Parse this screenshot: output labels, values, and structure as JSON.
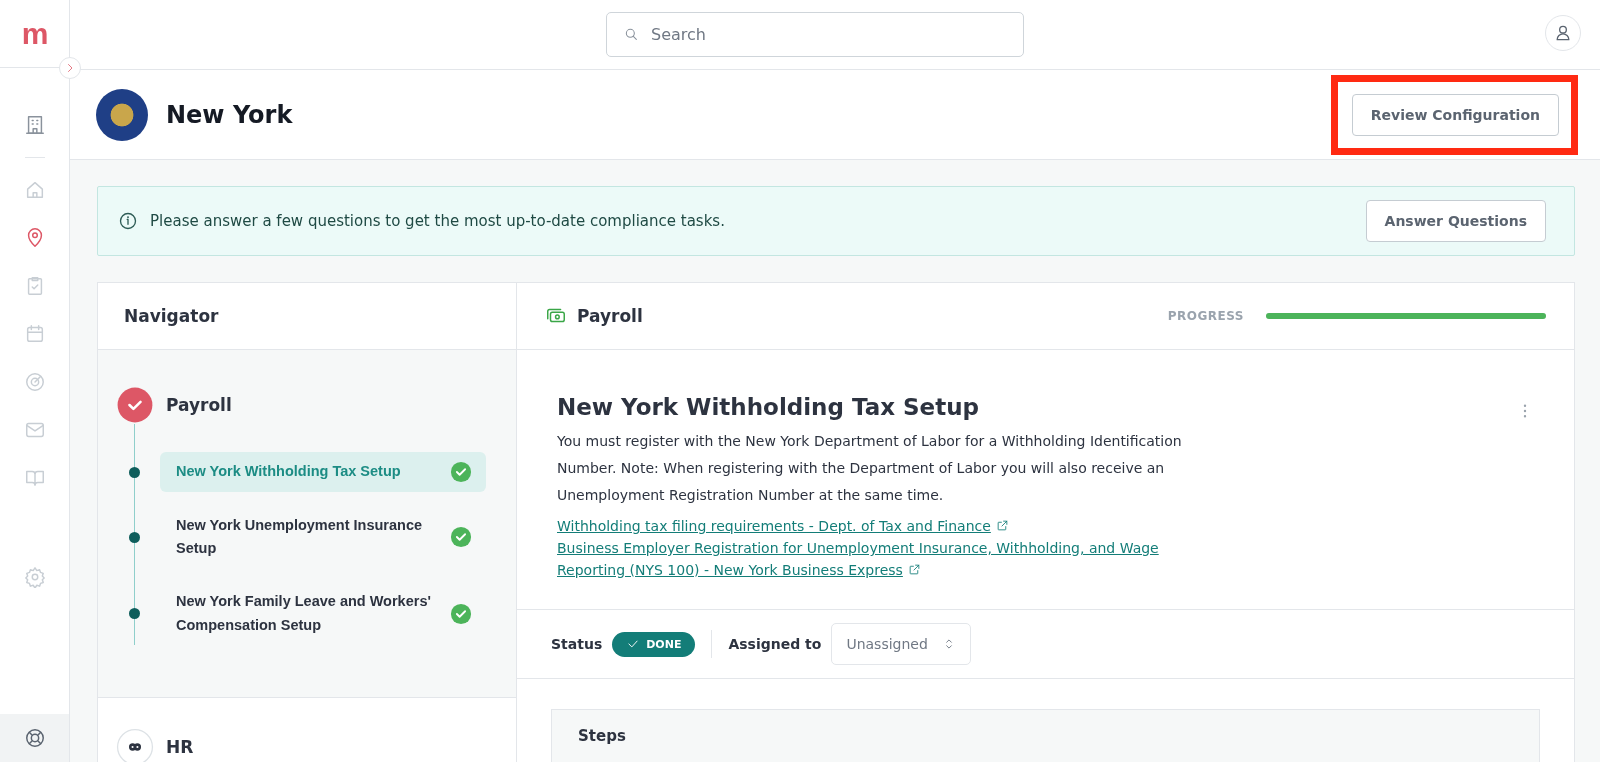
{
  "app": {
    "logo": "m"
  },
  "sidebar": {
    "items": [
      {
        "kind": "building",
        "selected": false
      },
      {
        "kind": "home",
        "selected": false
      },
      {
        "kind": "pin",
        "selected": true
      },
      {
        "kind": "clipboard",
        "selected": false
      },
      {
        "kind": "calendar",
        "selected": false
      },
      {
        "kind": "target",
        "selected": false
      },
      {
        "kind": "mail",
        "selected": false
      },
      {
        "kind": "book",
        "selected": false
      },
      {
        "kind": "gear",
        "selected": false
      }
    ]
  },
  "search": {
    "placeholder": "Search"
  },
  "header": {
    "title": "New York",
    "button": {
      "label": "Review Configuration",
      "highlighted": true
    }
  },
  "banner": {
    "text": "Please answer a few questions to get the most up-to-date compliance tasks.",
    "button": "Answer Questions"
  },
  "navigator": {
    "title": "Navigator",
    "groups": [
      {
        "title": "Payroll",
        "done": true,
        "expanded": true,
        "tasks": [
          {
            "label": "New York Withholding Tax Setup",
            "selected": true,
            "done": true
          },
          {
            "label": "New York Unemployment Insurance Setup",
            "selected": false,
            "done": true
          },
          {
            "label": "New York Family Leave and Workers' Compensation Setup",
            "selected": false,
            "done": true
          }
        ]
      },
      {
        "title": "HR",
        "done": false,
        "expanded": false
      }
    ]
  },
  "detail": {
    "section": "Payroll",
    "progress_label": "PROGRESS",
    "progress": {
      "level": 1.0
    },
    "title": "New York Withholding Tax Setup",
    "description": "You must register with the New York Department of Labor for a Withholding Identification Number. Note: When registering with the Department of Labor you will also receive an Unemployment Registration Number at the same time.",
    "links": [
      "Withholding tax filing requirements - Dept. of Tax and Finance",
      "Business Employer Registration for Unemployment Insurance, Withholding, and Wage Reporting (NYS 100) - New York Business Express"
    ],
    "status_label": "Status",
    "status": {
      "text": "DONE",
      "done": true
    },
    "assigned_label": "Assigned to",
    "assignee": "Unassigned",
    "steps_title": "Steps"
  }
}
